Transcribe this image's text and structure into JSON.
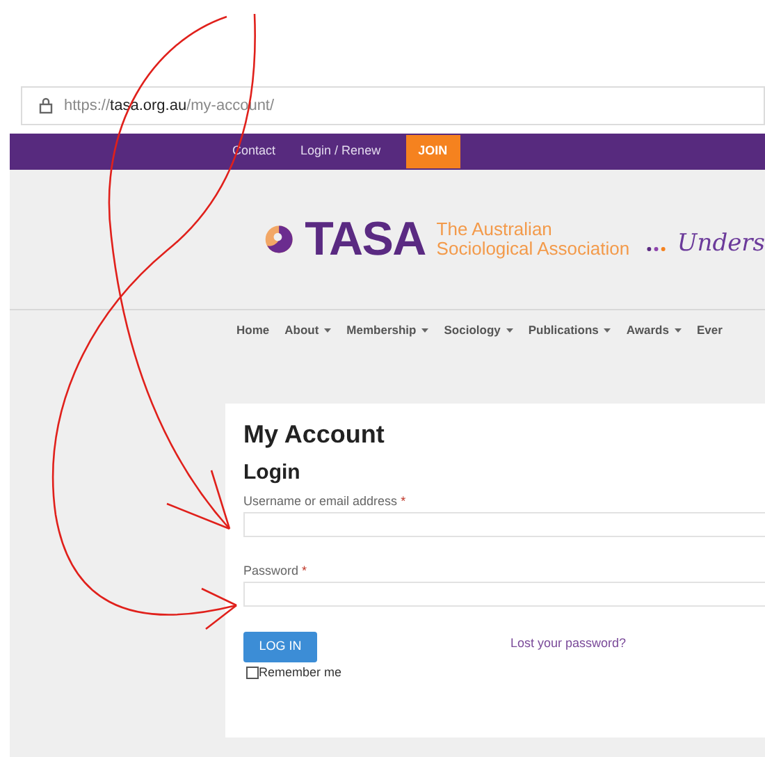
{
  "browser": {
    "url_scheme": "https://",
    "url_host": "tasa.org.au",
    "url_path": "/my-account/"
  },
  "top_bar": {
    "links": [
      {
        "label": "Contact",
        "kind": "link"
      },
      {
        "label": "Login / Renew",
        "kind": "link"
      },
      {
        "label": "JOIN",
        "kind": "button"
      }
    ]
  },
  "header": {
    "logo_text": "TASA",
    "subtitle_lines": [
      "The Australian",
      "Sociological Association"
    ],
    "tagline": "Unders"
  },
  "nav": [
    {
      "label": "Home",
      "has_menu": false
    },
    {
      "label": "About",
      "has_menu": true
    },
    {
      "label": "Membership",
      "has_menu": true
    },
    {
      "label": "Sociology",
      "has_menu": true
    },
    {
      "label": "Publications",
      "has_menu": true
    },
    {
      "label": "Awards",
      "has_menu": true
    },
    {
      "label": "Ever",
      "has_menu": false
    }
  ],
  "account": {
    "title": "My Account",
    "form_title": "Login",
    "fields": [
      {
        "label": "Username or email address",
        "required_mark": "*"
      },
      {
        "label": "Password",
        "required_mark": "*"
      }
    ],
    "submit": "LOG IN",
    "lost_password": "Lost your password?",
    "remember": {
      "label": "Remember me",
      "checked": false
    }
  }
}
